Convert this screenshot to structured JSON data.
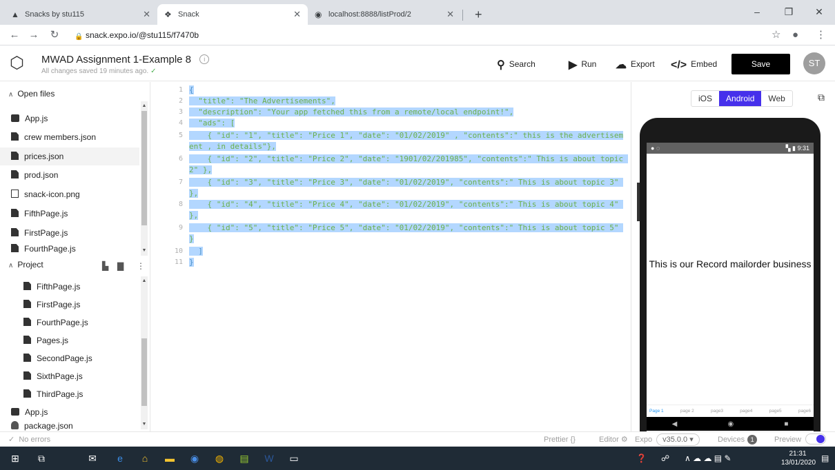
{
  "browser": {
    "tabs": [
      {
        "title": "Snacks by stu115",
        "icon": "expo-icon"
      },
      {
        "title": "Snack",
        "icon": "snack-icon"
      },
      {
        "title": "localhost:8888/listProd/2",
        "icon": "globe-icon"
      }
    ],
    "url": "snack.expo.io/@stu115/f7470b"
  },
  "header": {
    "project_title": "MWAD Assignment 1-Example 8",
    "save_status": "All changes saved 19 minutes ago.",
    "actions": {
      "search": "Search",
      "run": "Run",
      "export": "Export",
      "embed": "Embed"
    },
    "save_label": "Save",
    "avatar_initials": "ST"
  },
  "sidebar": {
    "open_files_label": "Open files",
    "open_files": [
      "App.js",
      "crew members.json",
      "prices.json",
      "prod.json",
      "snack-icon.png",
      "FifthPage.js",
      "FirstPage.js",
      "FourthPage.js"
    ],
    "project_label": "Project",
    "project_files": [
      "FifthPage.js",
      "FirstPage.js",
      "FourthPage.js",
      "Pages.js",
      "SecondPage.js",
      "SixthPage.js",
      "ThirdPage.js",
      "App.js",
      "package.json"
    ]
  },
  "editor": {
    "line_numbers": [
      "1",
      "2",
      "3",
      "4",
      "5",
      "6",
      "7",
      "8",
      "9",
      "10",
      "11"
    ],
    "lines": [
      "{",
      "  \"title\": \"The Advertisements\",",
      "  \"description\": \"Your app fetched this from a remote/local endpoint!\",",
      "  \"ads\": [",
      "    { \"id\": \"1\", \"title\": \"Price 1\", \"date\": \"01/02/2019\" , \"contents\":\" this is the advertisement , in details\"},",
      "    { \"id\": \"2\", \"title\": \"Price 2\", \"date\": \"1901/02/201985\", \"contents\":\" This is about topic 2\" },",
      "    { \"id\": \"3\", \"title\": \"Price 3\", \"date\": \"01/02/2019\", \"contents\":\" This is about topic 3\" },",
      "    { \"id\": \"4\", \"title\": \"Price 4\", \"date\": \"01/02/2019\", \"contents\":\" This is about topic 4\" },",
      "    { \"id\": \"5\", \"title\": \"Price 5\", \"date\": \"01/02/2019\", \"contents\":\" This is about topic 5\" }",
      "  ]",
      "}"
    ]
  },
  "preview": {
    "platforms": [
      "iOS",
      "Android",
      "Web"
    ],
    "selected_platform": "Android",
    "status_time": "9:31",
    "screen_text": "This is our Record mailorder business",
    "bottom_tabs": [
      "Page 1",
      "page 2",
      "page3",
      "page4",
      "page5",
      "page6"
    ]
  },
  "footer": {
    "errors": "No errors",
    "prettier": "Prettier",
    "prettier_icon": "{}",
    "editor": "Editor",
    "expo": "Expo",
    "sdk_version": "v35.0.0",
    "devices": "Devices",
    "device_count": "1",
    "preview": "Preview"
  },
  "taskbar": {
    "time": "21:31",
    "date": "13/01/2020"
  },
  "colors": {
    "accent": "#4630eb",
    "save_button": "#000000",
    "selection": "#b3d7ff",
    "json_string": "#6ab04c",
    "taskbar": "#1f2b36"
  }
}
